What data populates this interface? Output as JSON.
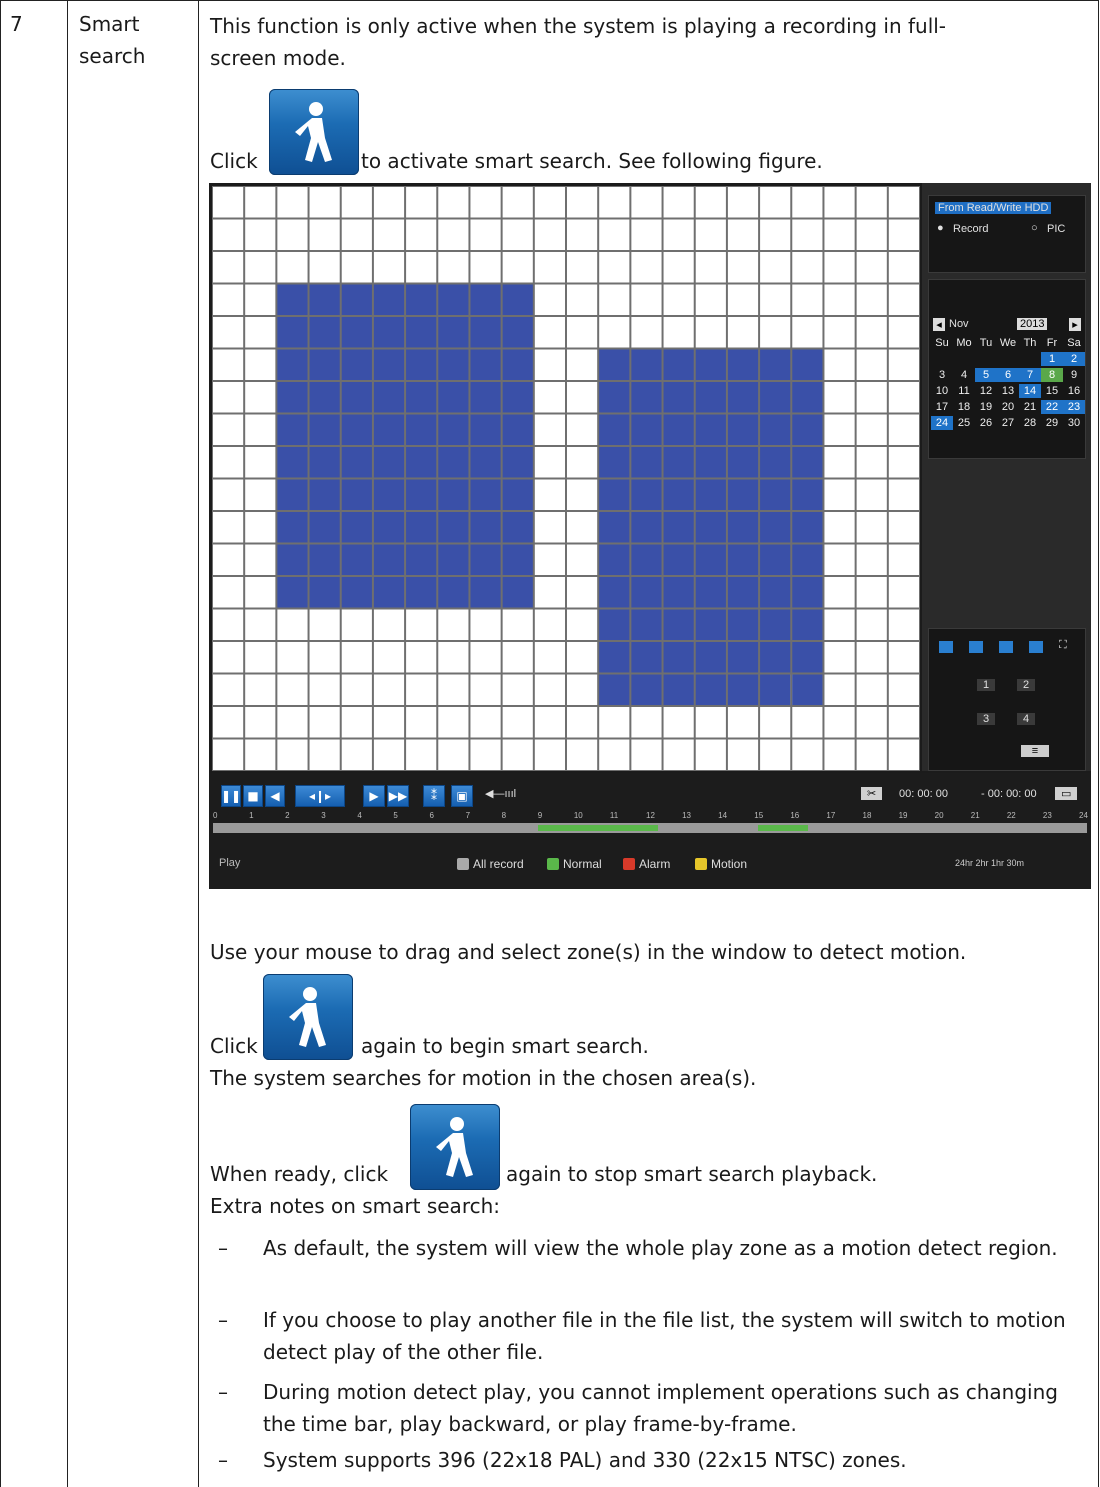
{
  "row": {
    "number": "7",
    "feature_line1": "Smart",
    "feature_line2": "search"
  },
  "content": {
    "intro_line1": "This function is only active when the system is playing a recording in full-",
    "intro_line2": "screen mode.",
    "click1_prefix": "Click",
    "click1_suffix": "to activate smart search. See following figure.",
    "drag_instruction": "Use your mouse to drag and select zone(s) in the window to detect motion.",
    "click2_prefix": "Click",
    "click2_suffix": "again to begin smart search.",
    "search_note": "The system searches for motion in the chosen area(s).",
    "click3_prefix": "When ready, click",
    "click3_suffix": "again to stop smart search playback.",
    "notes_heading": "Extra notes on smart search:",
    "bullet_dash": "–",
    "notes": [
      "As default, the system will view the whole play zone as a motion detect region.",
      "If you choose to play another file in the file list, the system will switch to motion detect play of the other file.",
      "During motion detect play, you cannot implement operations such as changing the time bar, play backward, or play frame-by-frame.",
      "System supports 396 (22x18 PAL) and 330 (22x15 NTSC) zones."
    ],
    "smart_search_icon": "walking-person-icon"
  },
  "figure": {
    "close": "×",
    "source_select": "From Read/Write HDD",
    "radio_record": "Record",
    "radio_pic": "PIC",
    "month": "Nov",
    "year": "2013",
    "weekdays": [
      "Su",
      "Mo",
      "Tu",
      "We",
      "Th",
      "Fr",
      "Sa"
    ],
    "weeks": [
      [
        "",
        "",
        "",
        "",
        "",
        "1",
        "2"
      ],
      [
        "3",
        "4",
        "5",
        "6",
        "7",
        "8",
        "9"
      ],
      [
        "10",
        "11",
        "12",
        "13",
        "14",
        "15",
        "16"
      ],
      [
        "17",
        "18",
        "19",
        "20",
        "21",
        "22",
        "23"
      ],
      [
        "24",
        "25",
        "26",
        "27",
        "28",
        "29",
        "30"
      ]
    ],
    "highlighted_days": [
      "1",
      "2",
      "5",
      "6",
      "7",
      "14",
      "22",
      "23",
      "24"
    ],
    "green_days": [
      "8"
    ],
    "channel_selects": [
      "1",
      "2",
      "3",
      "4"
    ],
    "time_start": "00: 00: 00",
    "time_end": "- 00: 00: 00",
    "timeline_ticks": [
      "0",
      "1",
      "2",
      "3",
      "4",
      "5",
      "6",
      "7",
      "8",
      "9",
      "10",
      "11",
      "12",
      "13",
      "14",
      "15",
      "16",
      "17",
      "18",
      "19",
      "20",
      "21",
      "22",
      "23",
      "24"
    ],
    "play_label": "Play",
    "legend": {
      "all_record": "All record",
      "normal": "Normal",
      "alarm": "Alarm",
      "motion": "Motion"
    },
    "zoom_labels": "24hr 2hr 1hr 30m",
    "accent_blue": "#3a50a8",
    "cols": 22,
    "rows": 18,
    "selected_zones": [
      {
        "col_start": 2,
        "col_end": 9,
        "row_start": 3,
        "row_end": 12
      },
      {
        "col_start": 12,
        "col_end": 18,
        "row_start": 5,
        "row_end": 15
      },
      {
        "col_start": 18,
        "col_end": 18,
        "row_start": 15,
        "row_end": 15,
        "outline": true
      }
    ]
  }
}
